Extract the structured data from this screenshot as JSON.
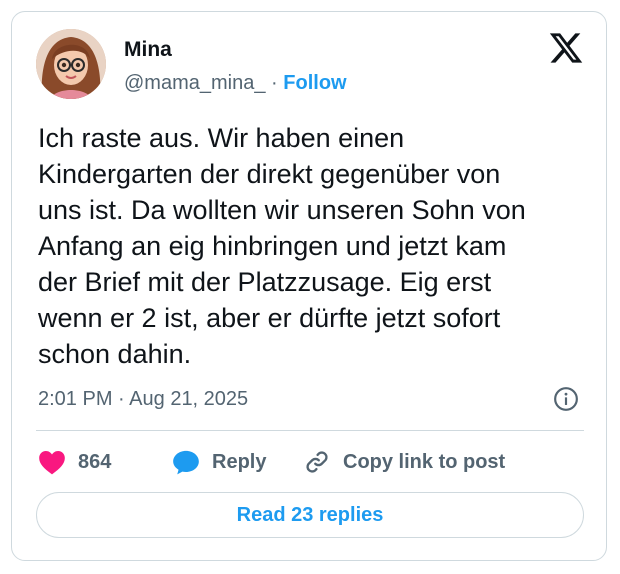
{
  "author": {
    "name": "Mina",
    "handle": "@mama_mina_",
    "separator": "·",
    "follow_label": "Follow"
  },
  "tweet": {
    "text": "Ich raste aus. Wir haben einen\nKindergarten der direkt gegenüber von\nuns ist. Da wollten wir unseren Sohn von\nAnfang an eig hinbringen und jetzt kam\nder Brief mit der Platzzusage. Eig erst\nwenn er 2 ist, aber er dürfte jetzt sofort\nschon dahin.",
    "time": "2:01 PM",
    "date": "Aug 21, 2025",
    "meta_separator": "·"
  },
  "actions": {
    "like_count": "864",
    "reply_label": "Reply",
    "copy_label": "Copy link to post"
  },
  "replies_button": {
    "label": "Read 23 replies"
  },
  "icons": {
    "logo": "x-logo-icon",
    "info": "info-icon",
    "like": "heart-icon",
    "reply": "speech-bubble-icon",
    "copy": "link-icon"
  },
  "colors": {
    "accent": "#1d9bf0",
    "like": "#f91880",
    "text": "#0f1419",
    "secondary": "#536471",
    "border": "#cfd9de"
  }
}
